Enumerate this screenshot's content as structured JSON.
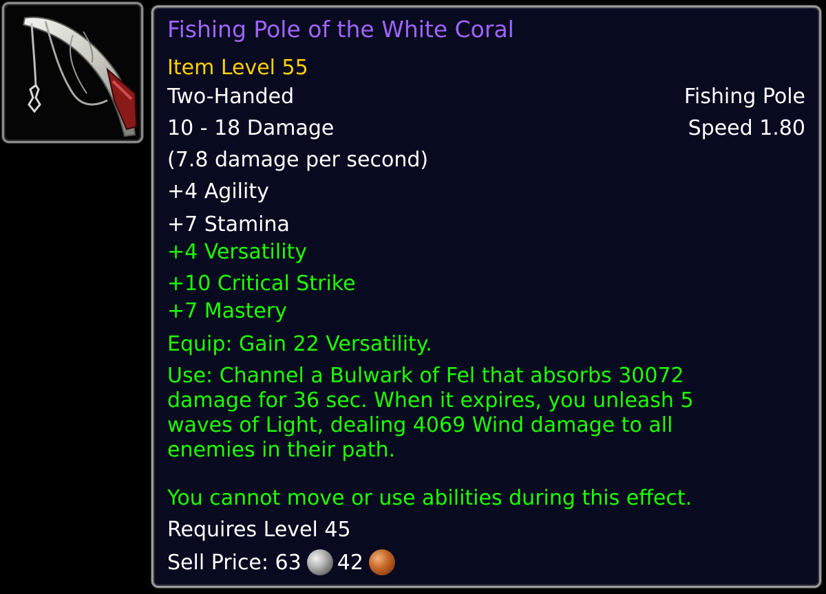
{
  "item": {
    "icon": "fishing-pole-icon",
    "name": "Fishing Pole of the White Coral",
    "item_level": "Item Level 55",
    "slot": "Two-Handed",
    "type": "Fishing Pole",
    "damage": "10 - 18 Damage",
    "speed": "Speed 1.80",
    "dps": "(7.8 damage per second)",
    "primary_stats": [
      "+4 Agility",
      "+7 Stamina"
    ],
    "secondary_stats": [
      "+4 Versatility",
      "+10 Critical Strike",
      "+7 Mastery"
    ],
    "equip": "Equip: Gain 22 Versatility.",
    "use_lines": [
      "Use: Channel a Bulwark of Fel that absorbs 30072",
      "damage for 36 sec. When it expires, you unleash 5",
      "waves of Light, dealing 4069 Wind damage to all",
      "enemies in their path."
    ],
    "use_note": "You cannot move or use abilities during this effect.",
    "requires": "Requires Level 45",
    "sell_label": "Sell Price:",
    "sell_silver": "63",
    "sell_copper": "42"
  },
  "colors": {
    "epic": "#a064ff",
    "item_level": "#ffd100",
    "green_text": "#1eff00",
    "white_text": "#ffffff",
    "tooltip_bg": "#080a1f"
  }
}
